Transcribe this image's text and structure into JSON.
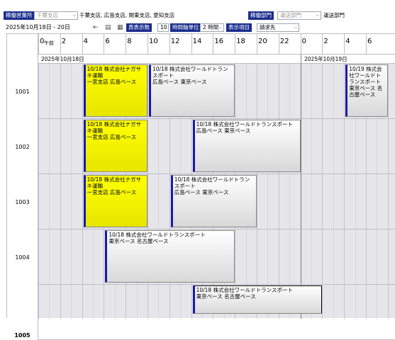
{
  "toolbar": {
    "office_label": "稼働営業所",
    "office_select": "千葉支店",
    "offices_text": "千葉支店, 広島支店, 関東支店, 愛知支店",
    "dept_label": "稼働部門",
    "dept_select": "運送部門",
    "dept_text": "運送部門",
    "date_range": "2025年10月18日 - 20日",
    "display_count_label": "頁表示数",
    "display_count_value": "10",
    "time_unit_label": "時間軸単位",
    "time_unit_value": "2 時間",
    "display_item_label": "表示項目",
    "display_item_value": "請求先"
  },
  "timeline": {
    "hours_day1": [
      "0",
      "2",
      "4",
      "6",
      "8",
      "10",
      "12",
      "14",
      "16",
      "18",
      "20",
      "22"
    ],
    "hours_day2": [
      "0",
      "2",
      "4",
      "6"
    ],
    "am_label": "午前",
    "day1_label": "2025年10月18日",
    "day2_label": "2025年10月19日"
  },
  "rows": [
    {
      "id": "1001"
    },
    {
      "id": "1002"
    },
    {
      "id": "1003"
    },
    {
      "id": "1004"
    },
    {
      "id": "1005"
    }
  ],
  "events": [
    {
      "text": "10/18 株式会社ナガサキ運輸\n一宮支店 広島ベース",
      "color": "yellow"
    },
    {
      "text": "10/18 株式会社ワールドトランスポート\n広島ベース 東京ベース",
      "color": "gray"
    },
    {
      "text": "10/19 株式会社ワールドトランスポート\n東京ベース 名古屋ベース",
      "color": "gray"
    },
    {
      "text": "10/18 株式会社ナガサキ運輸\n一宮支店 広島ベース",
      "color": "yellow"
    },
    {
      "text": "10/18 株式会社ワールドトランスポート\n広島ベース 東京ベース",
      "color": "gray"
    },
    {
      "text": "10/18 株式会社ナガサキ運輸\n一宮支店 広島ベース",
      "color": "yellow"
    },
    {
      "text": "10/18 株式会社ワールドトランスポート\n広島ベース 東京ベース",
      "color": "gray"
    },
    {
      "text": "10/18 株式会社ワールドトランスポート\n東京ベース 名古屋ベース",
      "color": "gray"
    },
    {
      "text": "10/18 株式会社ワールドトランスポート\n東京ベース 名古屋ベース",
      "color": "gray"
    }
  ],
  "colors": {
    "accent": "#1a2c8c",
    "event_border": "#1a1aa8",
    "yellow": "#ffff00",
    "grid_bg": "#e6e6ea"
  }
}
